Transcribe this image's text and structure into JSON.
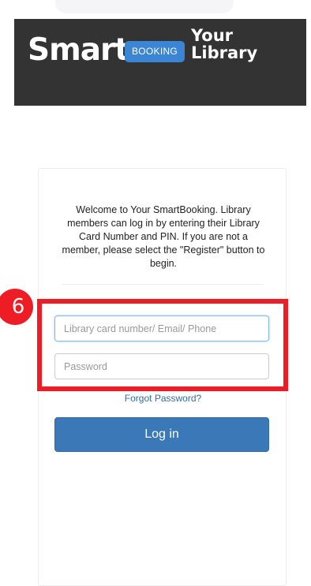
{
  "logo": {
    "smart": "Smart",
    "booking": "BOOKING",
    "your_library": "Your\nLibrary"
  },
  "welcome_text": "Welcome to Your SmartBooking. Library members can log in by entering their Library Card Number and PIN. If you are not a member, please select the \"Register\" button to begin.",
  "form": {
    "username_placeholder": "Library card number/ Email/ Phone",
    "password_placeholder": "Password",
    "forgot_label": "Forgot Password?",
    "login_label": "Log in"
  },
  "annotation": {
    "step": "6",
    "color": "#ee1c24"
  },
  "colors": {
    "banner_bg": "#333333",
    "badge_blue": "#3a86d4",
    "button_blue": "#3a78b8",
    "link_blue": "#2f6ea8"
  }
}
